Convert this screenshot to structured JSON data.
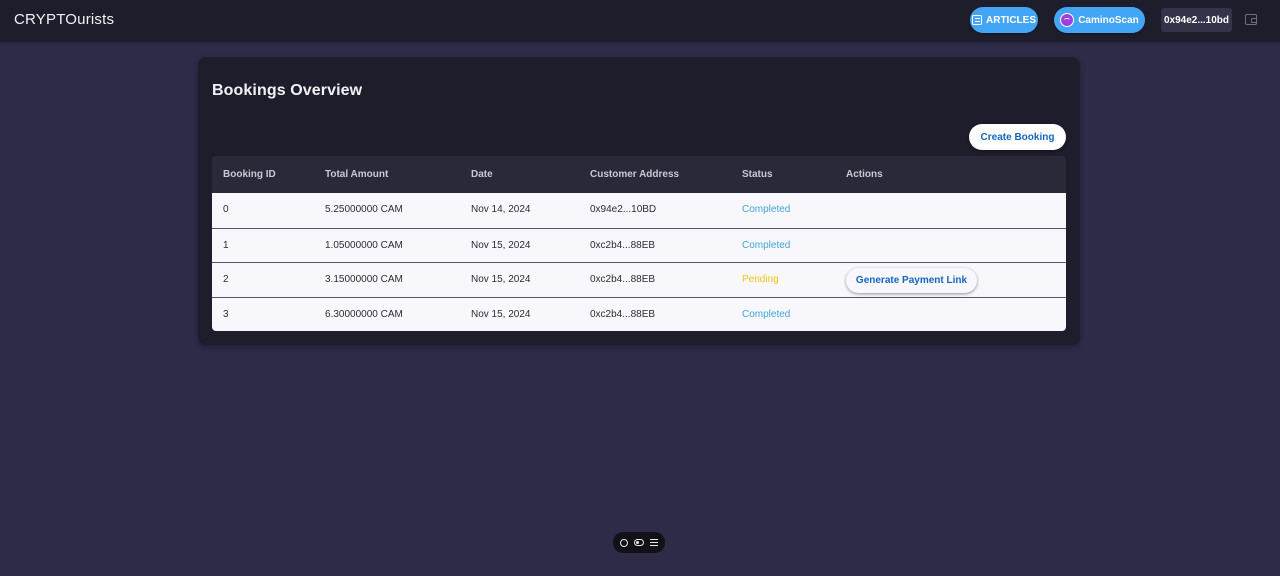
{
  "header": {
    "brand": "CRYPTOurists",
    "articles_label": "ARTICLES",
    "camino_label": "CaminoScan",
    "wallet_address": "0x94e2...10bd"
  },
  "page": {
    "title": "Bookings Overview",
    "create_label": "Create Booking"
  },
  "table": {
    "columns": [
      "Booking ID",
      "Total Amount",
      "Date",
      "Customer Address",
      "Status",
      "Actions"
    ],
    "rows": [
      {
        "id": "0",
        "amount": "5.25000000 CAM",
        "date": "Nov 14, 2024",
        "address": "0x94e2...10BD",
        "status": "Completed",
        "action": ""
      },
      {
        "id": "1",
        "amount": "1.05000000 CAM",
        "date": "Nov 15, 2024",
        "address": "0xc2b4...88EB",
        "status": "Completed",
        "action": ""
      },
      {
        "id": "2",
        "amount": "3.15000000 CAM",
        "date": "Nov 15, 2024",
        "address": "0xc2b4...88EB",
        "status": "Pending",
        "action": "Generate Payment Link"
      },
      {
        "id": "3",
        "amount": "6.30000000 CAM",
        "date": "Nov 15, 2024",
        "address": "0xc2b4...88EB",
        "status": "Completed",
        "action": ""
      }
    ]
  },
  "colors": {
    "background": "#2d2b48",
    "surface": "#1e1d2c",
    "accent": "#42a5f5",
    "status_completed": "#42a5d8",
    "status_pending": "#f2c418"
  },
  "icons": {
    "articles": "newspaper-icon",
    "camino": "camino-logo-icon",
    "wallet": "wallet-icon",
    "toolbar": [
      "chat-icon",
      "toggle-icon",
      "menu-icon"
    ]
  }
}
